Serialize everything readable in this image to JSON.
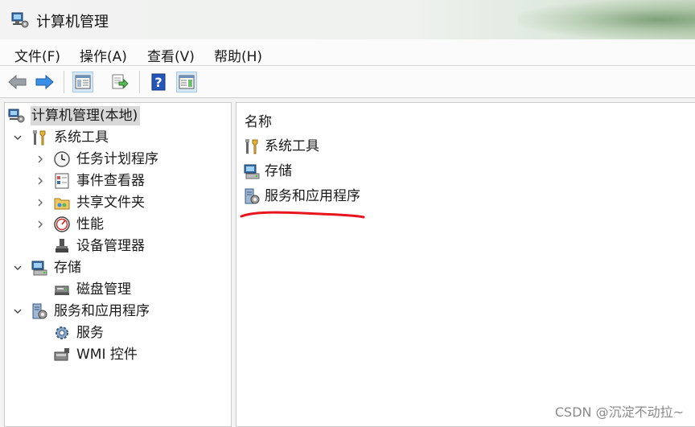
{
  "window": {
    "title": "计算机管理"
  },
  "menu": {
    "items": [
      "文件(F)",
      "操作(A)",
      "查看(V)",
      "帮助(H)"
    ]
  },
  "toolbar": {
    "buttons": [
      "back-icon",
      "forward-icon",
      "show-hide-tree-icon",
      "export-list-icon",
      "help-icon",
      "show-hide-action-pane-icon"
    ]
  },
  "tree": {
    "root": "计算机管理(本地)",
    "system_tools": "系统工具",
    "task_scheduler": "任务计划程序",
    "event_viewer": "事件查看器",
    "shared_folders": "共享文件夹",
    "performance": "性能",
    "device_manager": "设备管理器",
    "storage": "存储",
    "disk_management": "磁盘管理",
    "services_apps": "服务和应用程序",
    "services": "服务",
    "wmi": "WMI 控件"
  },
  "list": {
    "column_name": "名称",
    "items": [
      "系统工具",
      "存储",
      "服务和应用程序"
    ]
  },
  "watermark": "CSDN @沉淀不动拉~",
  "colors": {
    "annotation": "#e8141e",
    "selection": "#d9d9d9",
    "pressed_button": "#d7e8f7"
  }
}
